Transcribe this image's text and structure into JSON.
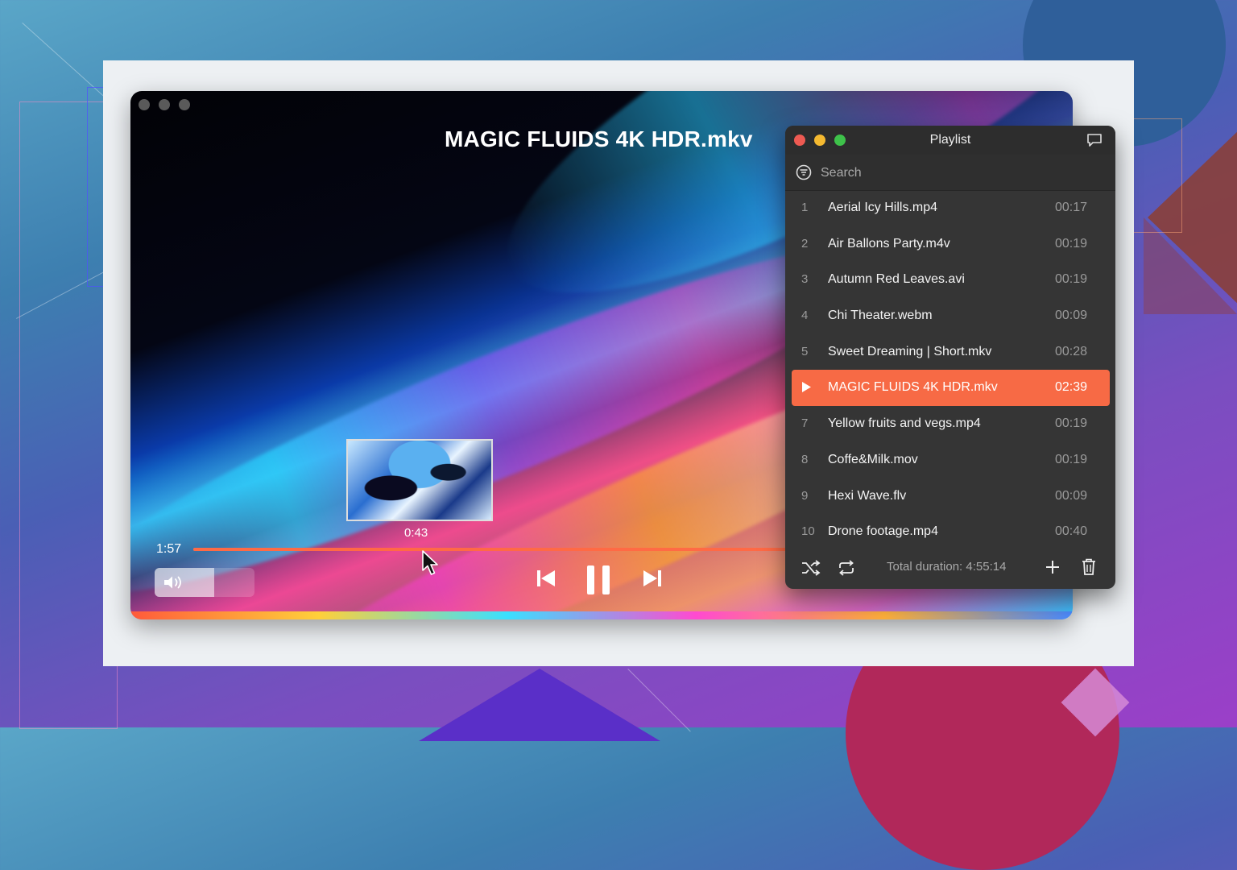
{
  "player": {
    "title": "MAGIC FLUIDS 4K HDR.mkv",
    "hover_time": "0:43",
    "current_time": "1:57",
    "progress": 0.996,
    "volume": 0.6
  },
  "playlist": {
    "title": "Playlist",
    "search_placeholder": "Search",
    "items": [
      {
        "num": "1",
        "name": "Aerial Icy Hills.mp4",
        "duration": "00:17"
      },
      {
        "num": "2",
        "name": "Air Ballons Party.m4v",
        "duration": "00:19"
      },
      {
        "num": "3",
        "name": "Autumn Red Leaves.avi",
        "duration": "00:19"
      },
      {
        "num": "4",
        "name": "Chi Theater.webm",
        "duration": "00:09"
      },
      {
        "num": "5",
        "name": "Sweet Dreaming | Short.mkv",
        "duration": "00:28"
      },
      {
        "num": "6",
        "name": "MAGIC FLUIDS 4K HDR.mkv",
        "duration": "02:39",
        "playing": true
      },
      {
        "num": "7",
        "name": "Yellow fruits and vegs.mp4",
        "duration": "00:19"
      },
      {
        "num": "8",
        "name": "Coffe&Milk.mov",
        "duration": "00:19"
      },
      {
        "num": "9",
        "name": "Hexi Wave.flv",
        "duration": "00:09"
      },
      {
        "num": "10",
        "name": "Drone footage.mp4",
        "duration": "00:40"
      }
    ],
    "total_duration": "Total duration: 4:55:14"
  },
  "colors": {
    "accent": "#f76a45",
    "window_close": "#ee5a52",
    "window_minimize": "#f5b930",
    "window_zoom": "#3ec24a"
  },
  "icons": {
    "shuffle": "shuffle-icon",
    "repeat": "repeat-icon",
    "add": "plus-icon",
    "delete": "trash-icon",
    "search": "filter-icon",
    "chat": "chat-icon",
    "volume": "speaker-icon",
    "prev": "skip-back-icon",
    "pause": "pause-icon",
    "next": "skip-forward-icon"
  }
}
